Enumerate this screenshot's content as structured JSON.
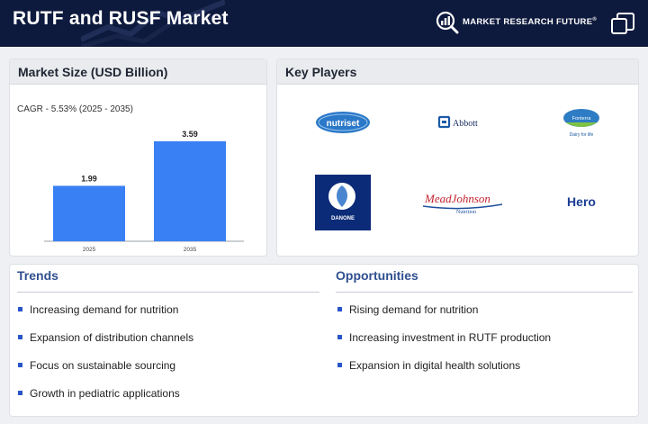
{
  "header": {
    "title": "RUTF and RUSF Market",
    "brand": "MARKET RESEARCH FUTURE",
    "brand_mark": "®"
  },
  "market_panel": {
    "title": "Market Size (USD Billion)",
    "cagr": "CAGR - 5.53% (2025 - 2035)"
  },
  "chart_data": {
    "type": "bar",
    "categories": [
      "2025",
      "2035"
    ],
    "values": [
      1.99,
      3.59
    ],
    "value_labels": [
      "1.99",
      "3.59"
    ],
    "ylim": [
      0,
      4.2
    ],
    "bar_color": "#3a80f5",
    "grid": false
  },
  "players_panel": {
    "title": "Key Players",
    "logos": [
      "nutriset",
      "Abbott",
      "Fonterra",
      "Dairy for life",
      "DANONE",
      "MeadJohnson",
      "Nutrition",
      "Hero"
    ]
  },
  "trends": {
    "title": "Trends",
    "items": [
      "Increasing demand for nutrition",
      "Expansion of distribution channels",
      "Focus on sustainable sourcing",
      "Growth in pediatric applications"
    ]
  },
  "opportunities": {
    "title": "Opportunities",
    "items": [
      "Rising demand for nutrition",
      "Increasing investment in RUTF production",
      "Expansion in digital health solutions"
    ]
  },
  "colors": {
    "header_bg": "#0e1a3d",
    "accent_blue": "#2855c9",
    "heading_blue": "#2f4f8f"
  }
}
